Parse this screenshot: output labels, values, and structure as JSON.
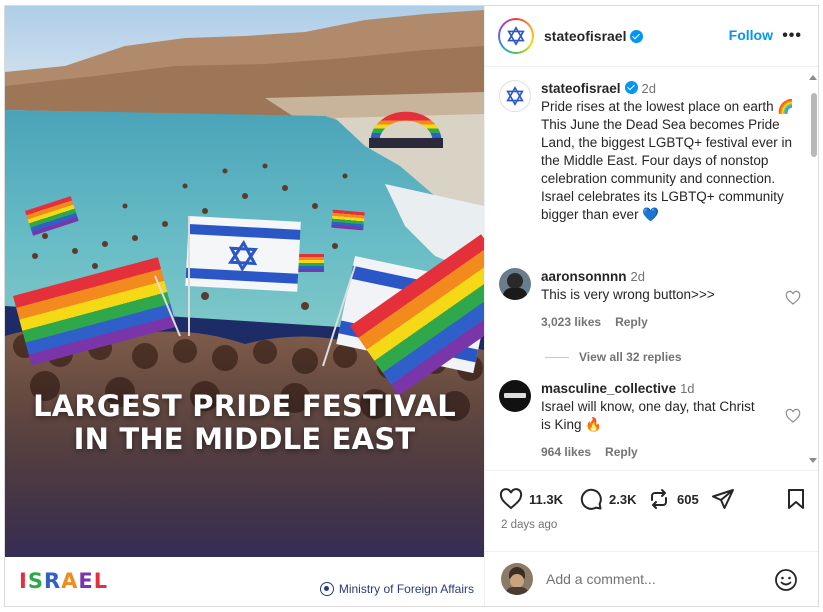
{
  "media": {
    "headline_line1": "LARGEST PRIDE FESTIVAL",
    "headline_line2": "IN THE MIDDLE EAST",
    "logo_text": "ISRAEL",
    "ministry": "Ministry of Foreign Affairs"
  },
  "header": {
    "username": "stateofisrael",
    "follow_label": "Follow",
    "more_label": "•••"
  },
  "caption": {
    "username": "stateofisrael",
    "time": "2d",
    "text": "Pride rises at the lowest place on earth 🌈  This June the Dead Sea becomes Pride Land, the biggest LGBTQ+ festival ever in the Middle East. Four days of nonstop celebration community and connection.  Israel celebrates its LGBTQ+ community bigger than ever 💙"
  },
  "comments": [
    {
      "username": "aaronsonnnn",
      "time": "2d",
      "text": "This is very wrong button>>>",
      "likes": "3,023 likes",
      "reply_label": "Reply"
    },
    {
      "username": "masculine_collective",
      "time": "1d",
      "text": "Israel will know, one day, that Christ is King 🔥",
      "likes": "964 likes",
      "reply_label": "Reply"
    }
  ],
  "view_replies": "View all 32 replies",
  "actions": {
    "likes": "11.3K",
    "comments": "2.3K",
    "reposts": "605",
    "posted": "2 days ago"
  },
  "add_comment": {
    "placeholder": "Add a comment..."
  },
  "colors": {
    "accent": "#0095f6",
    "text": "#262626",
    "muted": "#737373"
  },
  "icons": [
    "star-of-david-icon",
    "verified-icon",
    "more-icon",
    "heart-icon",
    "comment-icon",
    "repost-icon",
    "share-icon",
    "bookmark-icon",
    "emoji-icon"
  ]
}
